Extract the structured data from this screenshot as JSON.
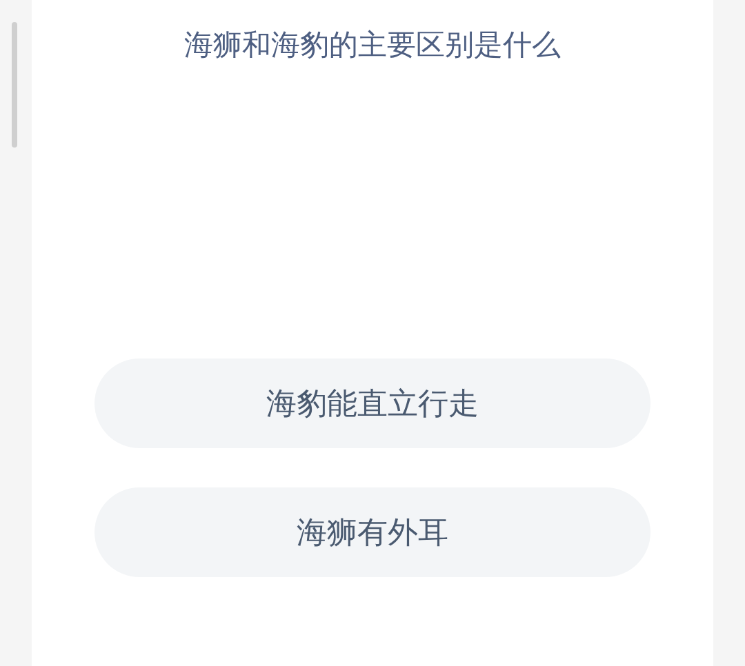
{
  "question": "海狮和海豹的主要区别是什么",
  "options": [
    {
      "label": "海豹能直立行走"
    },
    {
      "label": "海狮有外耳"
    }
  ]
}
